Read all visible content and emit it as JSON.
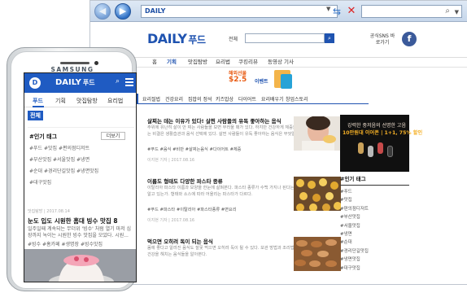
{
  "browser": {
    "address": "DAILY",
    "search_value": "",
    "colors": {
      "chrome": "#c6d6ea",
      "accent": "#1f53b0"
    }
  },
  "site": {
    "logo_main": "DAILY",
    "logo_sub": "푸드",
    "search_scope": "전체",
    "sns_label": "공식SNS 바로가기",
    "fb_glyph": "f",
    "gnb": [
      "홈",
      "기획",
      "맛집탐방",
      "요리법",
      "쿠킹리뷰",
      "동영상 기사"
    ],
    "gnb_active": 1,
    "banner": {
      "line1": "해외선물",
      "line2": "$2.5",
      "line3": "이벤트"
    },
    "subnav": [
      "전체",
      "요리절법",
      "건강요리",
      "집밥의 정석",
      "키즈밥상",
      "다이어트",
      "요리배우기",
      "창업스토리"
    ],
    "articles": [
      {
        "title": "살찌는 데는 이유가 있다! 살찐 사람들의 유독 좋아하는 음식",
        "summary": "주위에 유난히 살이 안 찌는 사람들을 보면 부러울 때가 있다. 하지만 건강하게 체중을 유지하는 비결은 생활습관과 음식 선택에 있다. 살찐 사람들이 유독 좋아하는 음식은 무엇일까.",
        "tags": "#푸드 #음식 #비만 #살찌는음식 #다이어트 #체중",
        "meta": "이지현 기자 | 2017.08.16"
      },
      {
        "title": "이름도 형태도 다양한 파스타 종류",
        "summary": "이탈리아 파스타 이름과 모양을 한눈에 살펴본다. 파스타 종류가 수백 가지나 된다는 사실을 알고 있는가. 형태와 소스에 따라 어울리는 파스타가 다르다.",
        "tags": "#푸드 #파스타 #이탈리아 #파스타종류 #면요리",
        "meta": "이지현 기자 | 2017.08.16"
      },
      {
        "title": "먹으면 오히려 독이 되는 음식",
        "summary": "몸에 좋다고 알려진 음식도 잘못 먹으면 오히려 독이 될 수 있다. 보관 방법과 조리법에 따라 건강을 해치는 음식들을 알아본다.",
        "tags": "",
        "meta": ""
      }
    ],
    "side_ad": {
      "line1": "강력한 중저음의 선명한 고음",
      "line2": "10만원대 이어폰 | 1+1, 75% 할인"
    },
    "popular_title": "#인기 태그",
    "popular_tags": [
      "#푸드",
      "#맛집",
      "#편의점디저트",
      "#부산맛집",
      "#서울맛집",
      "#냉면",
      "#순대",
      "#경리단길맛집",
      "#냉면맛집",
      "#대구맛집"
    ]
  },
  "phone": {
    "brand": "SAMSUNG",
    "logo_main": "DAILY",
    "logo_sub": "푸드",
    "logo_badge": "D",
    "tabs": [
      "푸드",
      "기획",
      "맛집탐방",
      "요리법"
    ],
    "chip": "전체",
    "popular_title": "#인기 태그",
    "more": "더보기",
    "tag_lines": [
      "#푸드 #맛집 #편의점디저트",
      "#부산맛집 #서울맛집 #냉면",
      "#순대 #경리단길맛집 #냉면맛집",
      "#대구맛집"
    ],
    "meta": "맛집탐방 | 2017.08.14",
    "article_title": "눈도 입도 시원한 홈대 빙수 맛집 8",
    "article_summary": "일주일째 계속되는 무더위 '빙수' 처럼 열기 마저 심장까지 녹이는 시원한 빙수 맛집을 모았다. 시원...",
    "article_tags": "#빙수 #홈카페 #생명장 #빙수맛집"
  }
}
